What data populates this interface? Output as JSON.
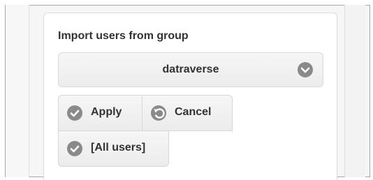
{
  "form": {
    "title": "Import users from group",
    "group_select": {
      "value": "datraverse",
      "icon": "chevron-down-icon"
    },
    "buttons": {
      "apply": {
        "label": "Apply",
        "icon": "check-icon"
      },
      "cancel": {
        "label": "Cancel",
        "icon": "undo-icon"
      },
      "all_users": {
        "label": "[All users]",
        "icon": "check-icon"
      }
    }
  },
  "colors": {
    "icon_bg": "#8a8a8a",
    "text": "#333333",
    "frame_border": "#a7a7a7"
  }
}
